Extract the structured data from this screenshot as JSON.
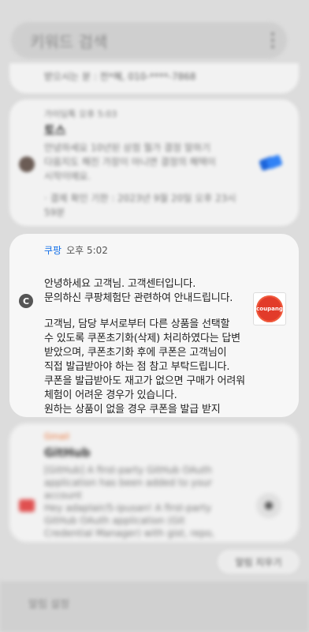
{
  "search": {
    "placeholder": "키워드 검색"
  },
  "partial_notification": {
    "text": "받으시는 분 : 전*혜, 010-****-7868"
  },
  "toss_card": {
    "header": "가이딩톡 오후 5:03",
    "title": "토스",
    "line1": "안녕하세요 10년된 상점 뭘가 결정 말하기",
    "line2": "다음지도 해진 가장이 아니면 결정의 해택이",
    "line3": "시작이에요.",
    "line4": "· 결제 확인 기한 : 2023년 9월 20일 오후 23시",
    "line5": "59분"
  },
  "coupang_card": {
    "app_name": "쿠팡",
    "time": "오후 5:02",
    "avatar_letter": "C",
    "logo_text": "coupang",
    "lines": [
      "안녕하세요 고객님. 고객센터입니다.",
      "문의하신 쿠팡체험단 관련하여 안내드립니다.",
      "고객님, 담당 부서로부터 다른 상품을 선택할",
      "수 있도록 쿠폰초기화(삭제) 처리하였다는 답변",
      "받았으며, 쿠폰초기화 후에 쿠폰은 고객님이",
      "직접 발급받아야 하는 점 참고 부탁드립니다.",
      "쿠폰을 발급받아도 재고가 없으면 구매가 어려워",
      "체험이 어려운 경우가 있습니다.",
      "원하는 상품이 없을 경우 쿠폰을 발급 받지"
    ]
  },
  "github_card": {
    "header": "Gmail",
    "title": "GitHub",
    "line1": "[GitHub] A first-party GitHub OAuth",
    "line2": "application has been added to your",
    "line3": "account",
    "line4": "Hey adaplair/5-ipusan! A first-party",
    "line5": "GitHub OAuth application (Git",
    "line6": "Credential Manager) with gist, repo,"
  },
  "pill_button": {
    "label": "알림 지우기"
  },
  "bottom_bar": {
    "label": "알림 설정"
  },
  "colors": {
    "coupang_red": "#e23b2a",
    "app_blue": "#1a73e8",
    "toss_blue": "#3182f6"
  }
}
